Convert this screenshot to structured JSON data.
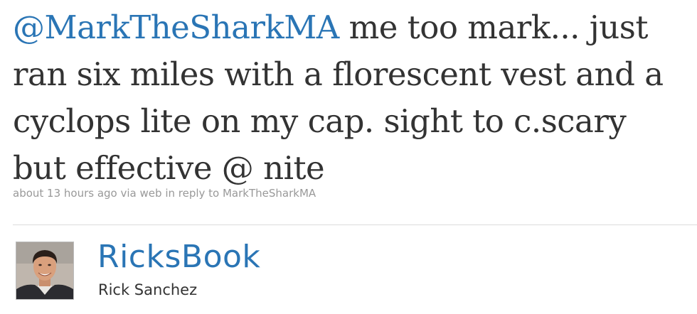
{
  "tweet": {
    "mention": "@MarkTheSharkMA",
    "text": " me too mark... just ran six miles with a florescent vest and a cyclops lite on my cap. sight to c.scary but effective @ nite",
    "meta": {
      "time": "about 13 hours ago",
      "via_prefix": " via ",
      "source": "web",
      "reply_prefix": " in reply to ",
      "reply_to": "MarkTheSharkMA"
    }
  },
  "author": {
    "screen_name": "RicksBook",
    "full_name": "Rick Sanchez",
    "avatar_icon": "profile-photo"
  },
  "colors": {
    "link": "#2a75b5",
    "text": "#333333",
    "meta": "#999999",
    "divider": "#dcdcdc"
  }
}
